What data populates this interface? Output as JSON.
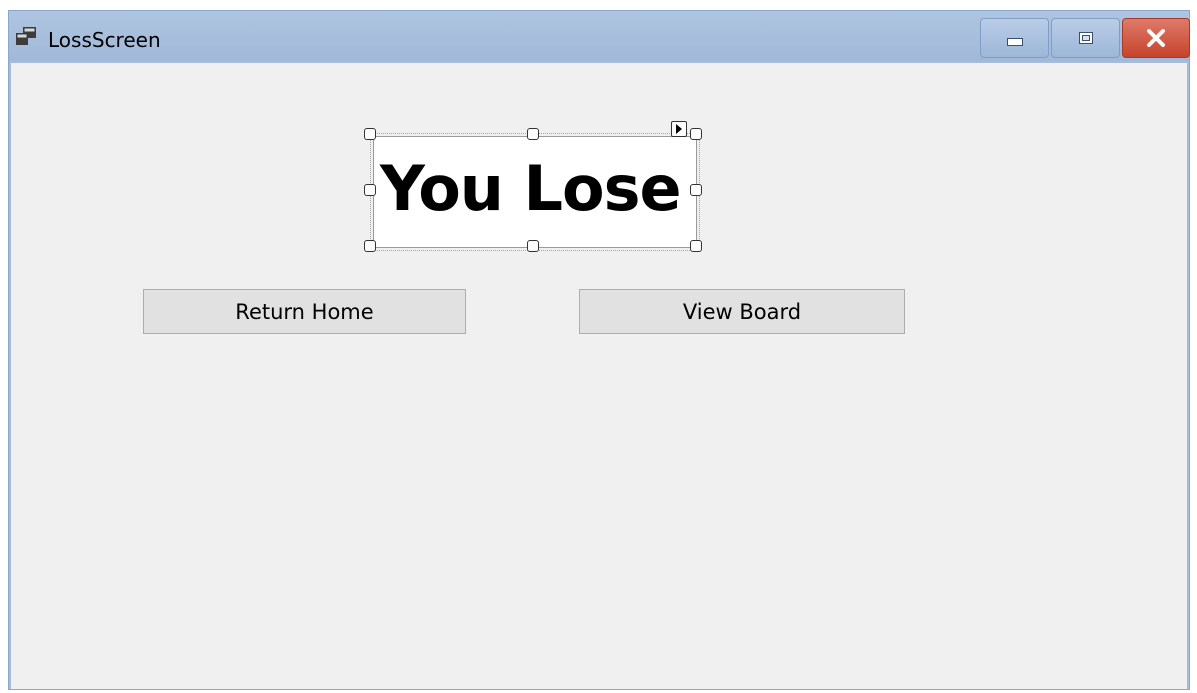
{
  "window": {
    "title": "LossScreen",
    "icon": "windows-form-icon",
    "controls": {
      "minimize_icon": "minimize-icon",
      "maximize_icon": "maximize-icon",
      "close_icon": "close-icon"
    }
  },
  "form": {
    "label_text": "You Lose",
    "smart_tag_icon": "smart-tag-arrow-icon",
    "buttons": {
      "return_home": "Return Home",
      "view_board": "View Board"
    }
  },
  "colors": {
    "titlebar": "#a5bddb",
    "close_button": "#c7432b",
    "client_background": "#f0f0f0",
    "button_background": "#e1e1e1"
  }
}
